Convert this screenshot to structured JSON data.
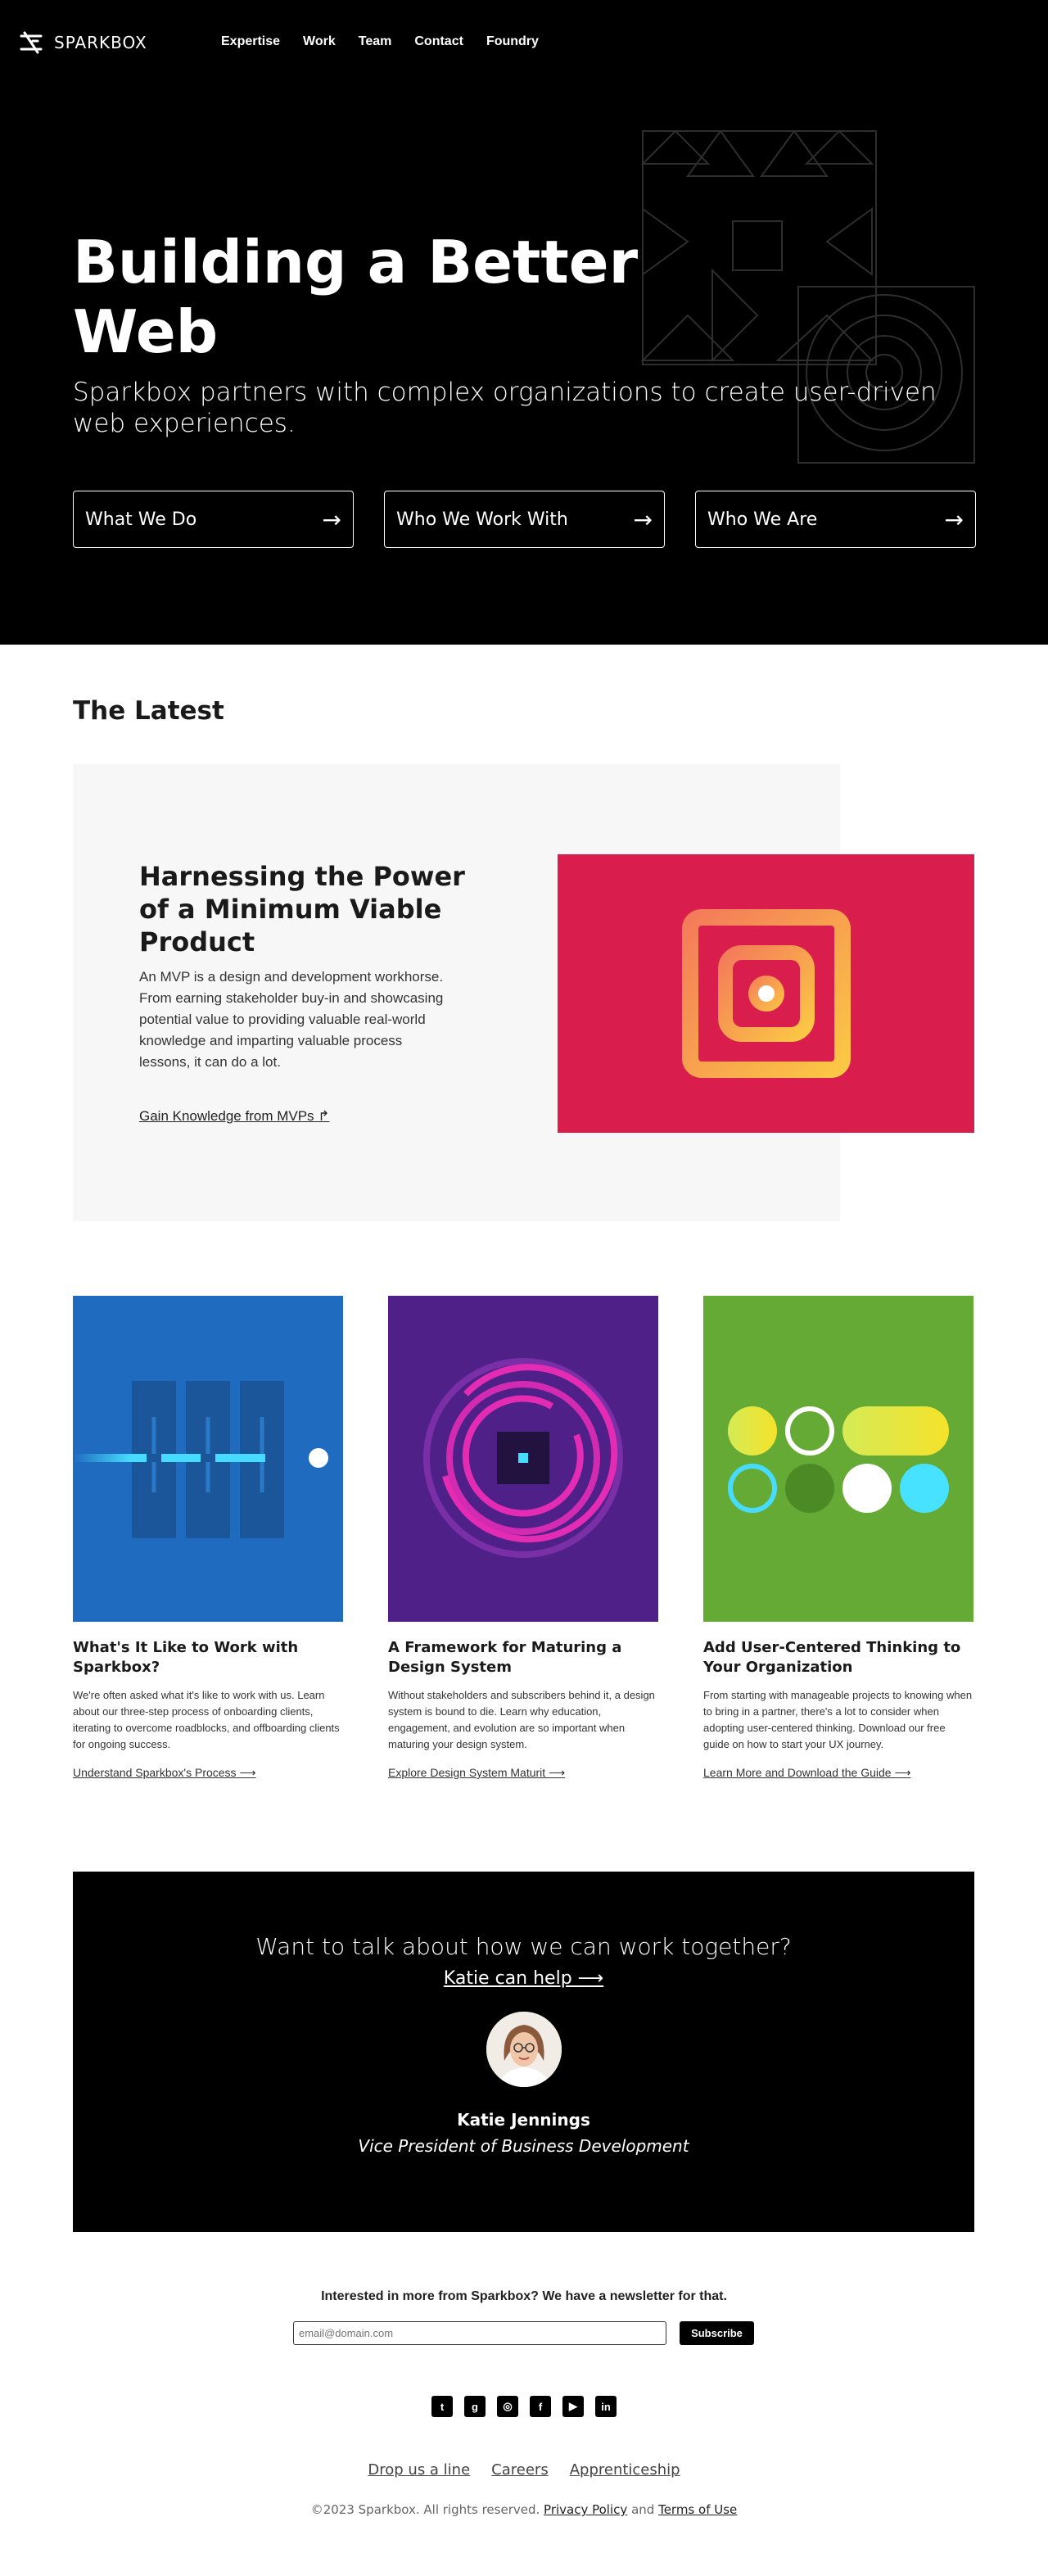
{
  "brand": {
    "name": "SPARKBOX"
  },
  "nav": {
    "items": [
      "Expertise",
      "Work",
      "Team",
      "Contact",
      "Foundry"
    ]
  },
  "hero": {
    "title": "Building a Better Web",
    "subtitle": "Sparkbox partners with complex organizations to create user-driven web experiences.",
    "ctas": [
      {
        "label": "What We Do",
        "arrow": "→"
      },
      {
        "label": "Who We Work With",
        "arrow": "→"
      },
      {
        "label": "Who We Are",
        "arrow": "→"
      }
    ]
  },
  "latest": {
    "heading": "The Latest",
    "feature": {
      "title": "Harnessing the Power of a Minimum Viable Product",
      "description": "An MVP is a design and development workhorse. From earning stakeholder buy-in and showcasing potential value to providing valuable real-world knowledge and imparting valuable process lessons, it can do a lot.",
      "link": "Gain Knowledge from MVPs ↱"
    },
    "cards": [
      {
        "title": "What's It Like to Work with Sparkbox?",
        "description": "We're often asked what it's like to work with us. Learn about our three-step process of onboarding clients, iterating to overcome roadblocks, and offboarding clients for ongoing success.",
        "link": "Understand Sparkbox's Process ⟶",
        "bg": "#1f6bbf"
      },
      {
        "title": "A Framework for Maturing a Design System",
        "description": "Without stakeholders and subscribers behind it, a design system is bound to die. Learn why education, engagement, and evolution are so important when maturing your design system.",
        "link": "Explore Design System Maturit ⟶",
        "bg": "#4f2188"
      },
      {
        "title": "Add User-Centered Thinking to Your Organization",
        "description": "From starting with manageable projects to knowing when to bring in a partner, there's a lot to consider when adopting user-centered thinking. Download our free guide on how to start your UX journey.",
        "link": "Learn More and Download the Guide ⟶",
        "bg": "#66aa36"
      }
    ]
  },
  "contact": {
    "question": "Want to talk about how we can work together?",
    "link": "Katie can help ⟶",
    "name": "Katie Jennings",
    "role": "Vice President of Business Development"
  },
  "newsletter": {
    "text": "Interested in more from Sparkbox? We have a newsletter for that.",
    "placeholder": "email@domain.com",
    "button": "Subscribe"
  },
  "socials": [
    {
      "icon": "twitter-icon",
      "glyph": "t"
    },
    {
      "icon": "github-icon",
      "glyph": "g"
    },
    {
      "icon": "dribbble-icon",
      "glyph": "◎"
    },
    {
      "icon": "facebook-icon",
      "glyph": "f"
    },
    {
      "icon": "youtube-icon",
      "glyph": "▶"
    },
    {
      "icon": "linkedin-icon",
      "glyph": "in"
    }
  ],
  "footer": {
    "links": [
      "Drop us a line",
      "Careers",
      "Apprenticeship"
    ],
    "copyright": "©2023 Sparkbox. All rights reserved.",
    "privacy": "Privacy Policy",
    "and": "and",
    "terms": "Terms of Use"
  },
  "colors": {
    "feature_image": "#d91e4d",
    "feature_bg": "#f7f7f7"
  }
}
